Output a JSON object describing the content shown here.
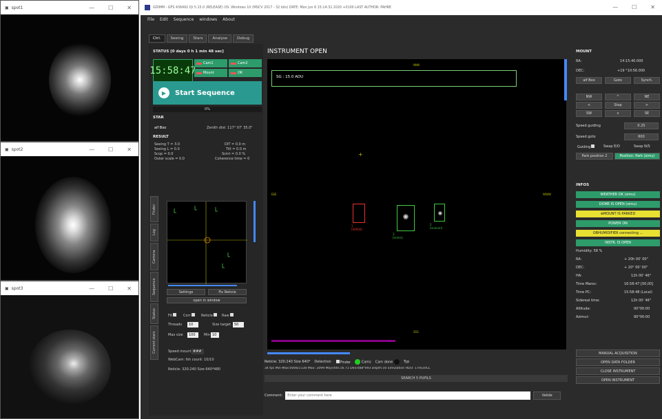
{
  "spot_windows": [
    {
      "title": "spot1"
    },
    {
      "title": "spot2"
    },
    {
      "title": "spot3"
    }
  ],
  "window_controls": {
    "min": "—",
    "max": "☐",
    "close": "✕"
  },
  "main_title": "GDIMM - GFS 436492 Qt 5.15.0 (RELEASE) OS: Windows 10 (MSCV 2017 - 32 bits)   DATE: Mon Jun 6 15:14:32 2020 +0100   LAST AUTHOR: PAHRE",
  "menu": [
    "File",
    "Edit",
    "Sequence",
    "windows",
    "About"
  ],
  "tabs": [
    "Ctrl.",
    "Seeing",
    "Stars",
    "Analyse",
    "Debug"
  ],
  "status": "STATUS   [0 days 0 h 1 min 48 sec]",
  "clock": "15:58:47",
  "mini_buttons": [
    "Cam1",
    "Cam2",
    "Mount",
    "OK"
  ],
  "start_label": "Start Sequence",
  "progress": "0%",
  "star": {
    "heading": "STAR",
    "name": "alf Boo",
    "zenith": "Zenith dist: 117° 07' 35.0\""
  },
  "result": {
    "heading": "RESULT",
    "l1a": "Seeing T = 3.0",
    "l1b": "DIT = 0.0 m",
    "l2a": "Seeing L = 0.0",
    "l2b": "Tilt = 0.0 m",
    "l3a": "Scop = 0.0",
    "l3b": "Scint = 0.0 %",
    "l4a": "Outer scale = 0.0",
    "l4b": "Coherence time = 0"
  },
  "side_tabs": [
    "Finder",
    "Log",
    "Camera",
    "Sequence",
    "Status",
    "Current stars"
  ],
  "scope_buttons": {
    "settings": "Settings",
    "fix": "Fix Reticle",
    "open": "open in window"
  },
  "checks": [
    "Fit",
    "Corr",
    "Reticle",
    "Raw"
  ],
  "threads": "Threads",
  "threads_val": "10",
  "size_target": "Size target",
  "size_val": "50",
  "max_size": "Max size",
  "max_val": "100",
  "min": "Min",
  "min_val": "10",
  "speed_mount": "Speed mount",
  "speed_mount_val": "###",
  "webcam": "WebCam: fsh count: 10/10",
  "reticle_line": "Reticle: 320:240  Size 640*480",
  "instrument_label": "INSTRUMENT OPEN",
  "inst_box": "SG : 15.0 ADU",
  "star_labels": [
    "1\n[00000]",
    "2\n[nnnnnn]",
    "3\n[nn/nn]"
  ],
  "compass": {
    "n": "NNN",
    "s": "SSS",
    "e": "EEE",
    "w": "WWW"
  },
  "bottom_line": {
    "reticle": "Reticle: 320:240  Size 640*",
    "detect": "Detection",
    "finder": "Finder",
    "cams": "Cams",
    "cam_done": "Cam done",
    "typ": "Typ"
  },
  "stats_line": "34 fps  Min-Max:0006/1130  Max: 2099  Moy:000.16.71  Dev:088*493  Depth:16  Simulation HDU: 17H/20CL",
  "search_btn": "SEARCH 5 PUPILS",
  "comment_label": "Comment:",
  "comment_placeholder": "Enter your comment here",
  "comment_btn": "Valide",
  "mount": {
    "heading": "MOUNT",
    "ra_l": "RA:",
    "ra": "14:15:40.000",
    "dec_l": "DEC:",
    "dec": "+19 °10:56.000",
    "sel": "alf Boo",
    "goto": "Goto",
    "sync": "Synch."
  },
  "dirs": [
    "NW",
    "^",
    "NE",
    "<",
    "Stop",
    ">",
    "SW",
    "v",
    "SE"
  ],
  "speed_guiding": "Speed guiding",
  "speed_guiding_val": "0.25",
  "speed_goto": "Speed goto",
  "speed_goto_val": "600",
  "guiding": "Guiding",
  "swap": "Swap E/O",
  "swap2": "Swap N/S",
  "park": "Park position 2",
  "park_btn": "Position: Park (simu)",
  "infos": {
    "heading": "INFOS",
    "weather": "WEATHER OK (simu)",
    "dome": "DOME IS OPEN (simu)",
    "mount": "MOUNT IS PARKED",
    "power": "POWER ON",
    "obs": "OBHUMIDIFIER connecting ...",
    "instr": "INSTR. IS OPEN"
  },
  "readouts": [
    [
      "Humidity: 58 %",
      ""
    ],
    [
      "RA:",
      "+ 20h 00' 00\""
    ],
    [
      "DEC:",
      "+ 20° 00' 00\""
    ],
    [
      "HA:",
      "12h 00' 46\""
    ],
    [
      "Time Maroc:",
      "16:58:47 [00,00]"
    ],
    [
      "Time PC:",
      "15:58:48 (Local)"
    ],
    [
      "Sidereal time:",
      "12h 00' 46\""
    ],
    [
      "Altitude:",
      "00°00:00"
    ],
    [
      "Azimut:",
      "90°00:00"
    ]
  ],
  "actions": [
    "MANUAL ACQUISITION",
    "OPEN DATA FOLDER",
    "CLOSE INSTRUMENT",
    "OPEN INSTRUMENT"
  ],
  "colors": {
    "green": "#2e9b6b",
    "yellow": "#e8e032",
    "teal": "#2a9a90"
  }
}
